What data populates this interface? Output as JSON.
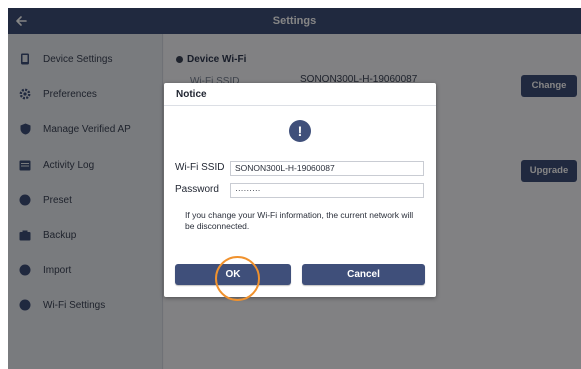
{
  "topbar": {
    "title": "Settings"
  },
  "sidebar": {
    "items": [
      {
        "label": "Device Settings",
        "icon": "tablet-icon"
      },
      {
        "label": "Preferences",
        "icon": "gear-icon"
      },
      {
        "label": "Manage Verified AP",
        "icon": "shield-icon"
      },
      {
        "label": "Activity Log",
        "icon": "log-icon"
      },
      {
        "label": "Preset",
        "icon": "preset-icon"
      },
      {
        "label": "Backup",
        "icon": "backup-icon"
      },
      {
        "label": "Import",
        "icon": "import-icon"
      },
      {
        "label": "Wi-Fi Settings",
        "icon": "wifi-icon"
      }
    ]
  },
  "main": {
    "section_title": "Device Wi-Fi",
    "wifi_ssid_label": "Wi-Fi SSID",
    "wifi_ssid_value": "SONON300L-H-19060087",
    "change_label": "Change",
    "upgrade_label": "Upgrade"
  },
  "dialog": {
    "title": "Notice",
    "icon": "info-icon",
    "icon_glyph": "!",
    "ssid_label": "Wi-Fi SSID",
    "ssid_value": "SONON300L-H-19060087",
    "password_label": "Password",
    "password_value": "·········",
    "message": "If you change your Wi-Fi information, the current network will be disconnected.",
    "ok_label": "OK",
    "cancel_label": "Cancel"
  },
  "colors": {
    "accent": "#3f4f7a",
    "highlight_ring": "#f0922e"
  }
}
